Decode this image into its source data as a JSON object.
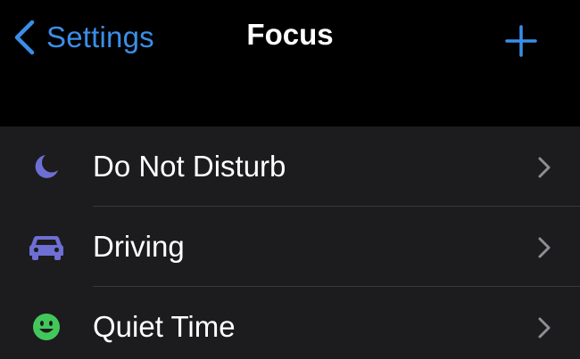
{
  "nav": {
    "back_label": "Settings",
    "title": "Focus",
    "add_icon": "plus-icon"
  },
  "colors": {
    "accent": "#3b8ee8",
    "background": "#000000",
    "list_background": "#1c1c1e",
    "do_not_disturb_icon": "#6e6fd4",
    "driving_icon": "#6e6fd4",
    "quiet_time_icon": "#43c75b"
  },
  "focus_modes": [
    {
      "label": "Do Not Disturb",
      "icon": "moon-icon"
    },
    {
      "label": "Driving",
      "icon": "car-icon"
    },
    {
      "label": "Quiet Time",
      "icon": "smiley-icon"
    }
  ]
}
